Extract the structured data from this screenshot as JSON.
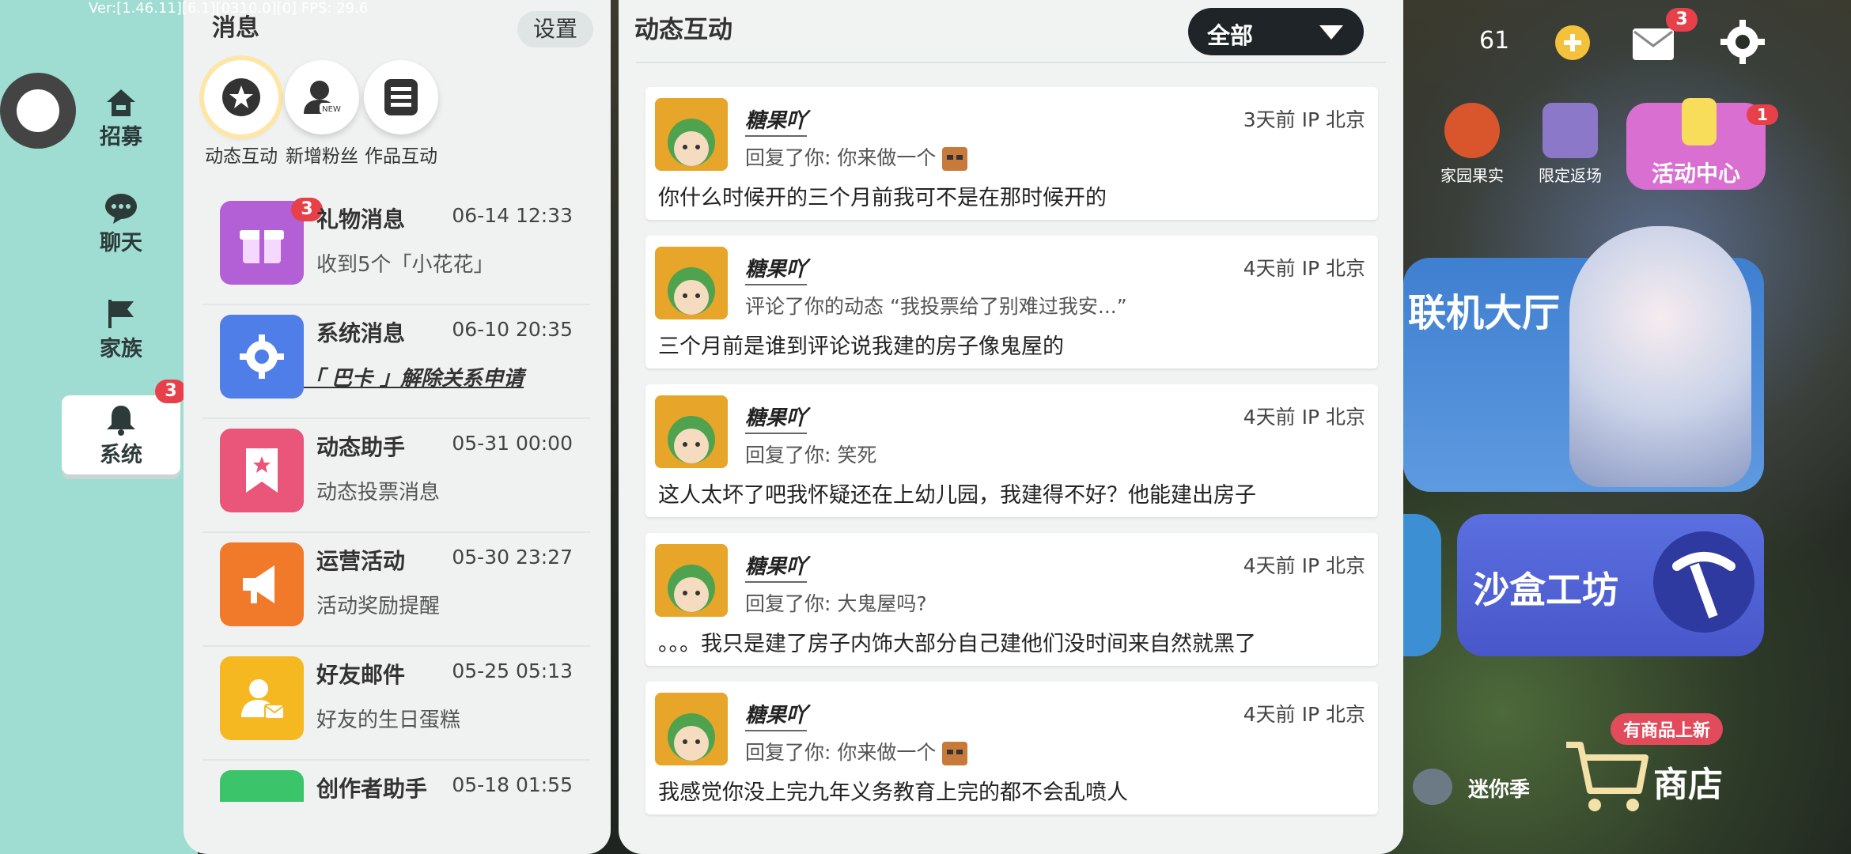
{
  "status": {
    "version": "Ver:[1.46.11][6.1][0310.0][0] FPS: 29.6"
  },
  "hud": {
    "currency": "61",
    "mail_badge": "3",
    "event_badge": "1",
    "home_fruit": "家园果实",
    "limited_return": "限定返场",
    "event_center": "活动中心",
    "lobby": "联机大厅",
    "sandbox": "沙盒工坊",
    "new_items": "有商品上新",
    "mini_season": "迷你季",
    "shop": "商店"
  },
  "left_rail": {
    "items": [
      {
        "label": "招募",
        "icon": "house-icon"
      },
      {
        "label": "聊天",
        "icon": "chat-icon"
      },
      {
        "label": "家族",
        "icon": "flag-icon"
      },
      {
        "label": "系统",
        "icon": "bell-icon",
        "badge": "3"
      }
    ]
  },
  "messages": {
    "title": "消息",
    "settings": "设置",
    "tabs": [
      {
        "label": "动态互动",
        "icon": "star-chat-icon"
      },
      {
        "label": "新增粉丝",
        "icon": "new-fan-icon"
      },
      {
        "label": "作品互动",
        "icon": "list-icon"
      }
    ],
    "rows": [
      {
        "name": "礼物消息",
        "time": "06-14 12:33",
        "sub": "收到5个「小花花」",
        "badge": "3",
        "color": "#b35fd6",
        "icon": "gift-icon"
      },
      {
        "name": "系统消息",
        "time": "06-10 20:35",
        "sub": "「 巴卡 」解除关系申请",
        "color": "#4f7ee8",
        "icon": "gear-icon"
      },
      {
        "name": "动态助手",
        "time": "05-31 00:00",
        "sub": "动态投票消息",
        "color": "#e9567a",
        "icon": "bookmark-star-icon"
      },
      {
        "name": "运营活动",
        "time": "05-30 23:27",
        "sub": "活动奖励提醒",
        "color": "#f07a2a",
        "icon": "megaphone-icon"
      },
      {
        "name": "好友邮件",
        "time": "05-25 05:13",
        "sub": "好友的生日蛋糕",
        "color": "#f5b820",
        "icon": "friend-mail-icon"
      },
      {
        "name": "创作者助手",
        "time": "05-18 01:55",
        "sub": "",
        "color": "#3cc46a",
        "icon": "creator-icon"
      }
    ]
  },
  "interactions": {
    "title": "动态互动",
    "filter": "全部",
    "cards": [
      {
        "user": "糖果吖",
        "meta": "3天前 IP 北京",
        "action": "回复了你: 你来做一个",
        "content": "你什么时候开的三个月前我可不是在那时候开的",
        "emoji": true
      },
      {
        "user": "糖果吖",
        "meta": "4天前 IP 北京",
        "action": "评论了你的动态 “我投票给了别难过我安...”",
        "content": "三个月前是谁到评论说我建的房子像鬼屋的",
        "emoji": false
      },
      {
        "user": "糖果吖",
        "meta": "4天前 IP 北京",
        "action": "回复了你: 笑死",
        "content": "这人太坏了吧我怀疑还在上幼儿园，我建得不好？他能建出房子",
        "emoji": false
      },
      {
        "user": "糖果吖",
        "meta": "4天前 IP 北京",
        "action": "回复了你: 大鬼屋吗?",
        "content": "。。。我只是建了房子内饰大部分自己建他们没时间来自然就黑了",
        "emoji": false
      },
      {
        "user": "糖果吖",
        "meta": "4天前 IP 北京",
        "action": "回复了你: 你来做一个",
        "content": "我感觉你没上完九年义务教育上完的都不会乱喷人",
        "emoji": true
      }
    ]
  }
}
